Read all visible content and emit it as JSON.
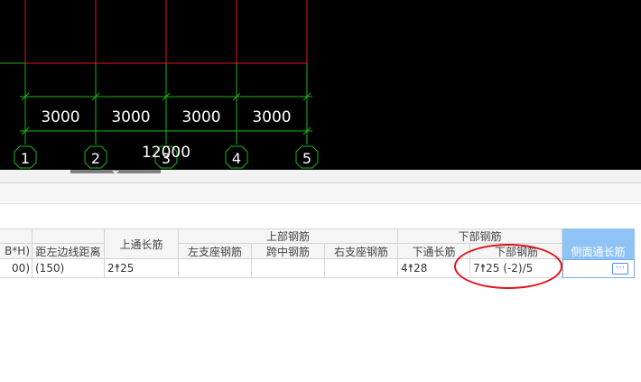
{
  "cad": {
    "spans": [
      "3000",
      "3000",
      "3000",
      "3000"
    ],
    "total": "12000",
    "axes": [
      "1",
      "2",
      "3",
      "4",
      "5"
    ]
  },
  "grid": {
    "headers": {
      "bh": "B*H)",
      "left_dist": "距左边线距离",
      "top_through": "上通长筋",
      "top_group": "上部钢筋",
      "left_support": "左支座钢筋",
      "mid_span": "跨中钢筋",
      "right_support": "右支座钢筋",
      "bottom_group": "下部钢筋",
      "bottom_through": "下通长筋",
      "bottom_rebar": "下部钢筋",
      "side_through": "侧面通长筋"
    },
    "row": {
      "bh": "00)",
      "left_dist": "(150)",
      "top_through": "2☨25",
      "left_support": "",
      "mid_span": "",
      "right_support": "",
      "bottom_through": "4☨28",
      "bottom_rebar": "7☨25 (-2)/5",
      "side_through": ""
    },
    "ellipsis": "⋯"
  }
}
